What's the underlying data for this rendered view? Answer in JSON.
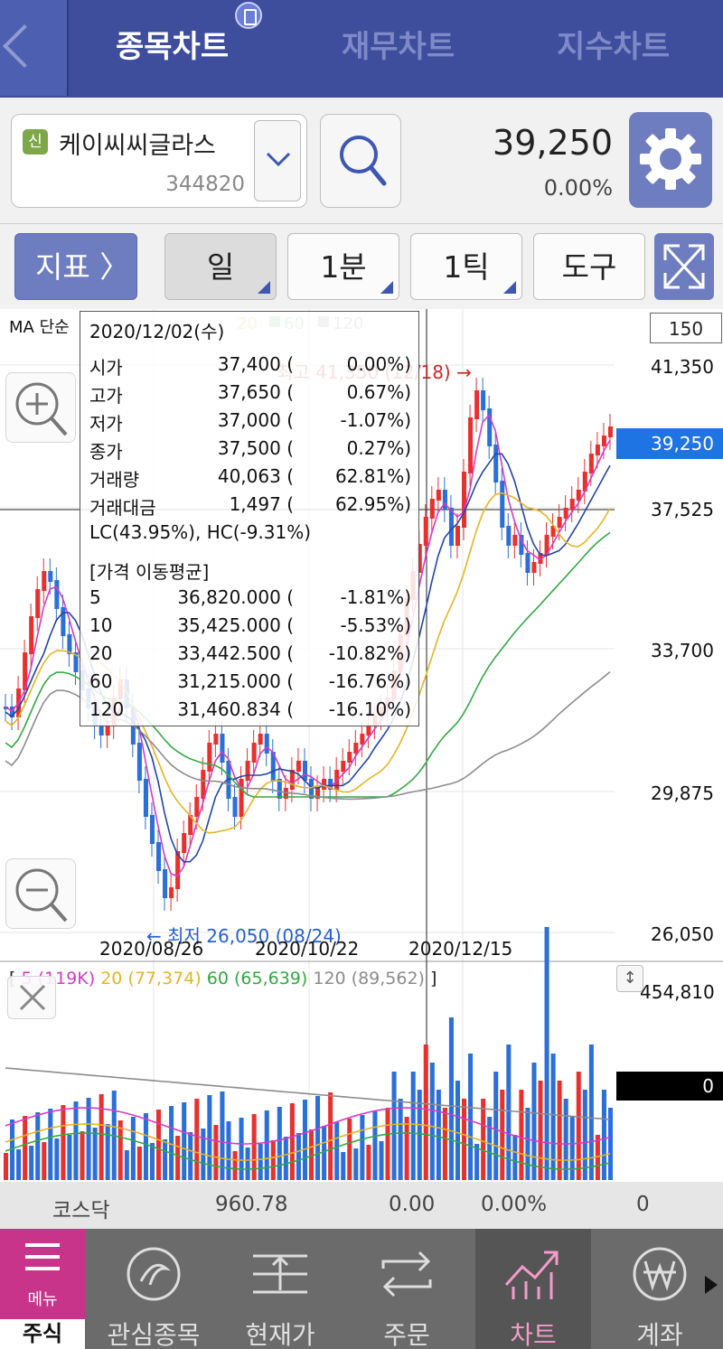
{
  "tabs": [
    {
      "label": "종목차트",
      "active": true
    },
    {
      "label": "재무차트",
      "active": false
    },
    {
      "label": "지수차트",
      "active": false
    }
  ],
  "stock": {
    "badge": "신",
    "name": "케이씨씨글라스",
    "code": "344820",
    "price": "39,250",
    "change_pct": "0.00%"
  },
  "toolbar": {
    "indicator_label": "지표 〉",
    "period": "일",
    "minute": "1분",
    "tick": "1틱",
    "tools": "도구"
  },
  "chart": {
    "ma_label": "MA 단순",
    "ma_legend_visible": [
      "20",
      "60",
      "120"
    ],
    "box_value": "150",
    "y_ticks": [
      "41,350",
      "37,525",
      "33,700",
      "29,875",
      "26,050"
    ],
    "current_price_flag": "39,250",
    "dates": [
      "2020/08/26",
      "2020/10/22",
      "2020/12/15"
    ],
    "high_annot": "최고 41,350 (12/18) →",
    "low_annot": "← 최저 26,050 (08/24)",
    "volume_legend": {
      "open": "[",
      "ma5": "5 (119K)",
      "ma20": "20 (77,374)",
      "ma60": "60 (65,639)",
      "ma120": "120 (89,562)",
      "close": "]"
    },
    "volume_top": "454,810",
    "volume_zero": "0",
    "colors": {
      "up": "#e8312f",
      "down": "#2b6fd8",
      "ma5": "#d63ac7",
      "ma10": "#2146a8",
      "ma20": "#e6b422",
      "ma60": "#32a843",
      "ma120": "#8c8c8c"
    }
  },
  "tooltip": {
    "date": "2020/12/02(수)",
    "rows": [
      {
        "k": "시가",
        "v": "37,400 (",
        "p": "0.00%)"
      },
      {
        "k": "고가",
        "v": "37,650 (",
        "p": "0.67%)"
      },
      {
        "k": "저가",
        "v": "37,000 (",
        "p": "-1.07%)"
      },
      {
        "k": "종가",
        "v": "37,500 (",
        "p": "0.27%)"
      },
      {
        "k": "거래량",
        "v": "40,063 (",
        "p": "62.81%)"
      },
      {
        "k": "거래대금",
        "v": "1,497 (",
        "p": "62.95%)"
      }
    ],
    "lc_hc": "LC(43.95%), HC(-9.31%)",
    "ma_header": "[가격 이동평균]",
    "ma_rows": [
      {
        "k": "5",
        "v": "36,820.000 (",
        "p": "-1.81%)"
      },
      {
        "k": "10",
        "v": "35,425.000 (",
        "p": "-5.53%)"
      },
      {
        "k": "20",
        "v": "33,442.500 (",
        "p": "-10.82%)"
      },
      {
        "k": "60",
        "v": "31,215.000 (",
        "p": "-16.76%)"
      },
      {
        "k": "120",
        "v": "31,460.834 (",
        "p": "-16.10%)"
      }
    ]
  },
  "kosdaq": {
    "name": "코스닥",
    "value": "960.78",
    "change": "0.00",
    "pct": "0.00%",
    "extra": "0"
  },
  "nav": {
    "menu": "메뉴",
    "sub": "주식",
    "items": [
      {
        "label": "관심종목",
        "icon": "interest-icon"
      },
      {
        "label": "현재가",
        "icon": "current-price-icon"
      },
      {
        "label": "주문",
        "icon": "order-icon"
      },
      {
        "label": "차트",
        "icon": "chart-icon",
        "active": true
      },
      {
        "label": "계좌",
        "icon": "won-icon"
      }
    ]
  }
}
